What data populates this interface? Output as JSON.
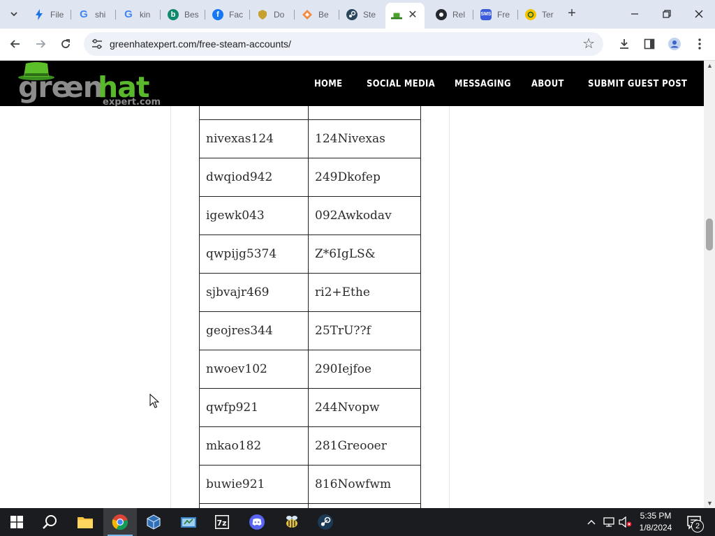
{
  "tabs": [
    {
      "title": "File",
      "icon": "bolt-icon",
      "color": "#1a73e8"
    },
    {
      "title": "shi",
      "icon": "google-icon",
      "color": "#4285f4"
    },
    {
      "title": "kin",
      "icon": "google-icon",
      "color": "#4285f4"
    },
    {
      "title": "Bes",
      "icon": "bing-icon",
      "color": "#0f8a6c"
    },
    {
      "title": "Fac",
      "icon": "facebook-icon",
      "color": "#1877f2"
    },
    {
      "title": "Do",
      "icon": "shield-icon",
      "color": "#c8a032"
    },
    {
      "title": "Be",
      "icon": "diamond-icon",
      "color": "#f28b40"
    },
    {
      "title": "Ste",
      "icon": "steam-icon",
      "color": "#2a475e"
    },
    {
      "title": "",
      "icon": "greenhat-icon",
      "color": "#4ca02c"
    },
    {
      "title": "Rel",
      "icon": "github-icon",
      "color": "#24292f"
    },
    {
      "title": "Fre",
      "icon": "sms-icon",
      "color": "#3b5bdb"
    },
    {
      "title": "Ter",
      "icon": "chat-icon",
      "color": "#f5c400"
    }
  ],
  "address": {
    "url": "greenhatexpert.com/free-steam-accounts/"
  },
  "site": {
    "logo_text_main": "greenhat",
    "logo_text_sub": "expert.com",
    "nav": [
      "HOME",
      "SOCIAL MEDIA",
      "MESSAGING",
      "ABOUT",
      "SUBMIT GUEST POST"
    ]
  },
  "accounts": [
    {
      "username": "nivexas124",
      "password": "124Nivexas"
    },
    {
      "username": "dwqiod942",
      "password": "249Dkofep"
    },
    {
      "username": "igewk043",
      "password": "092Awkodav"
    },
    {
      "username": "qwpijg5374",
      "password": "Z*6IgLS&"
    },
    {
      "username": "sjbvajr469",
      "password": "ri2+Ethe"
    },
    {
      "username": "geojres344",
      "password": "25TrU??f"
    },
    {
      "username": "nwoev102",
      "password": "290Iejfoe"
    },
    {
      "username": "qwfp921",
      "password": "244Nvopw"
    },
    {
      "username": "mkao182",
      "password": "281Greooer"
    },
    {
      "username": "buwie921",
      "password": "816Nowfwm"
    }
  ],
  "taskbar": {
    "time": "5:35 PM",
    "date": "1/8/2024",
    "notifications": "2"
  }
}
